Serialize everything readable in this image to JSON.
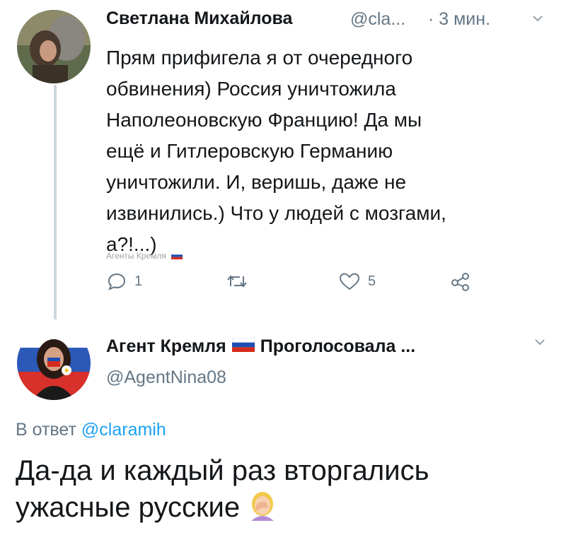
{
  "tweet1": {
    "author_name": "Светлана Михайлова",
    "handle": "@cla...",
    "time": "· 3 мин.",
    "text_lines": [
      "Прям прифигела я от очередного",
      "обвинения) Россия уничтожила",
      "Наполеоновскую Францию! Да мы",
      "ещё и Гитлеровскую Германию",
      "уничтожили. И, веришь, даже не",
      "извинились.)  Что у людей с мозгами,",
      "а?!...)"
    ],
    "watermark": "Агенты Кремля",
    "actions": {
      "reply_count": "1",
      "retweet_count": "",
      "like_count": "5"
    }
  },
  "tweet2": {
    "author_name_part1": "Агент Кремля",
    "author_name_part2": "Проголосовала ...",
    "handle": "@AgentNina08",
    "reply_prefix": "В ответ",
    "reply_mention": "@claramih",
    "text_lines": [
      "Да-да и каждый раз вторгались",
      "ужасные русские"
    ]
  },
  "icons": {
    "caret": "chevron-down-icon",
    "reply": "reply-icon",
    "retweet": "retweet-icon",
    "like": "heart-icon",
    "share": "share-icon",
    "flag": "russian-flag-icon",
    "emoji": "facepalm-emoji-icon"
  },
  "colors": {
    "text": "#14171a",
    "secondary": "#657786",
    "link": "#1da1f2",
    "thread_line": "#ccd6dd"
  }
}
